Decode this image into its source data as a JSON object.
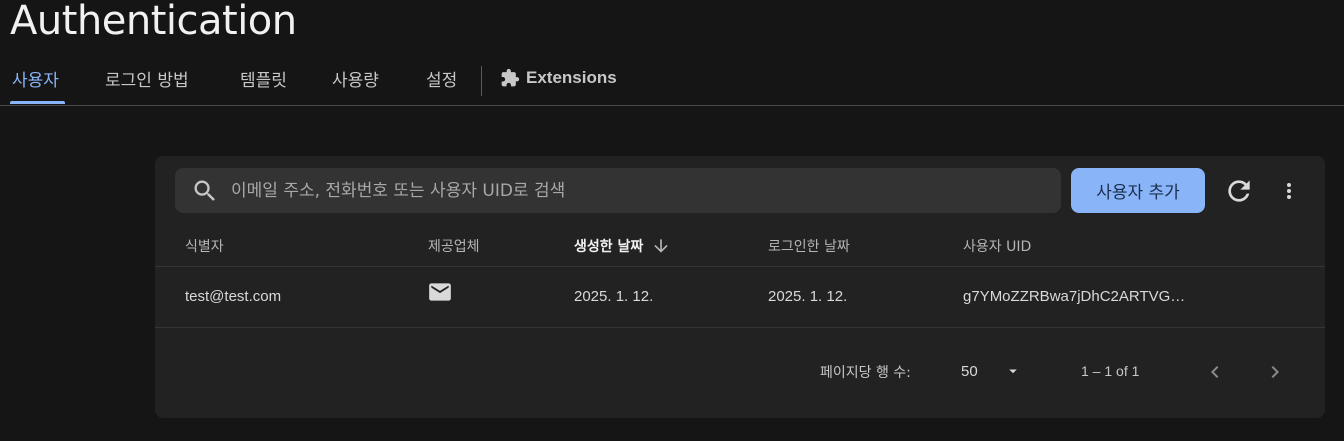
{
  "page": {
    "title": "Authentication"
  },
  "tabs": [
    {
      "label": "사용자",
      "active": true
    },
    {
      "label": "로그인 방법"
    },
    {
      "label": "템플릿"
    },
    {
      "label": "사용량"
    },
    {
      "label": "설정"
    }
  ],
  "extensions_tab": {
    "label": "Extensions",
    "icon": "puzzle-icon"
  },
  "toolbar": {
    "search_placeholder": "이메일 주소, 전화번호 또는 사용자 UID로 검색",
    "add_user_label": "사용자 추가",
    "refresh_icon": "refresh-icon",
    "more_icon": "more-vert-icon"
  },
  "table": {
    "columns": [
      "식별자",
      "제공업체",
      "생성한 날짜",
      "로그인한 날짜",
      "사용자 UID"
    ],
    "sorted_column": "생성한 날짜",
    "rows": [
      {
        "identifier": "test@test.com",
        "provider_icon": "mail-icon",
        "created": "2025. 1. 12.",
        "signed_in": "2025. 1. 12.",
        "uid": "g7YMoZZRBwa7jDhC2ARTVG…"
      }
    ]
  },
  "pagination": {
    "rows_per_page_label": "페이지당 행 수:",
    "rows_per_page_value": "50",
    "range_label": "1 – 1 of 1"
  },
  "colors": {
    "accent": "#8ab4f8",
    "background": "#151515",
    "card": "#222222"
  }
}
